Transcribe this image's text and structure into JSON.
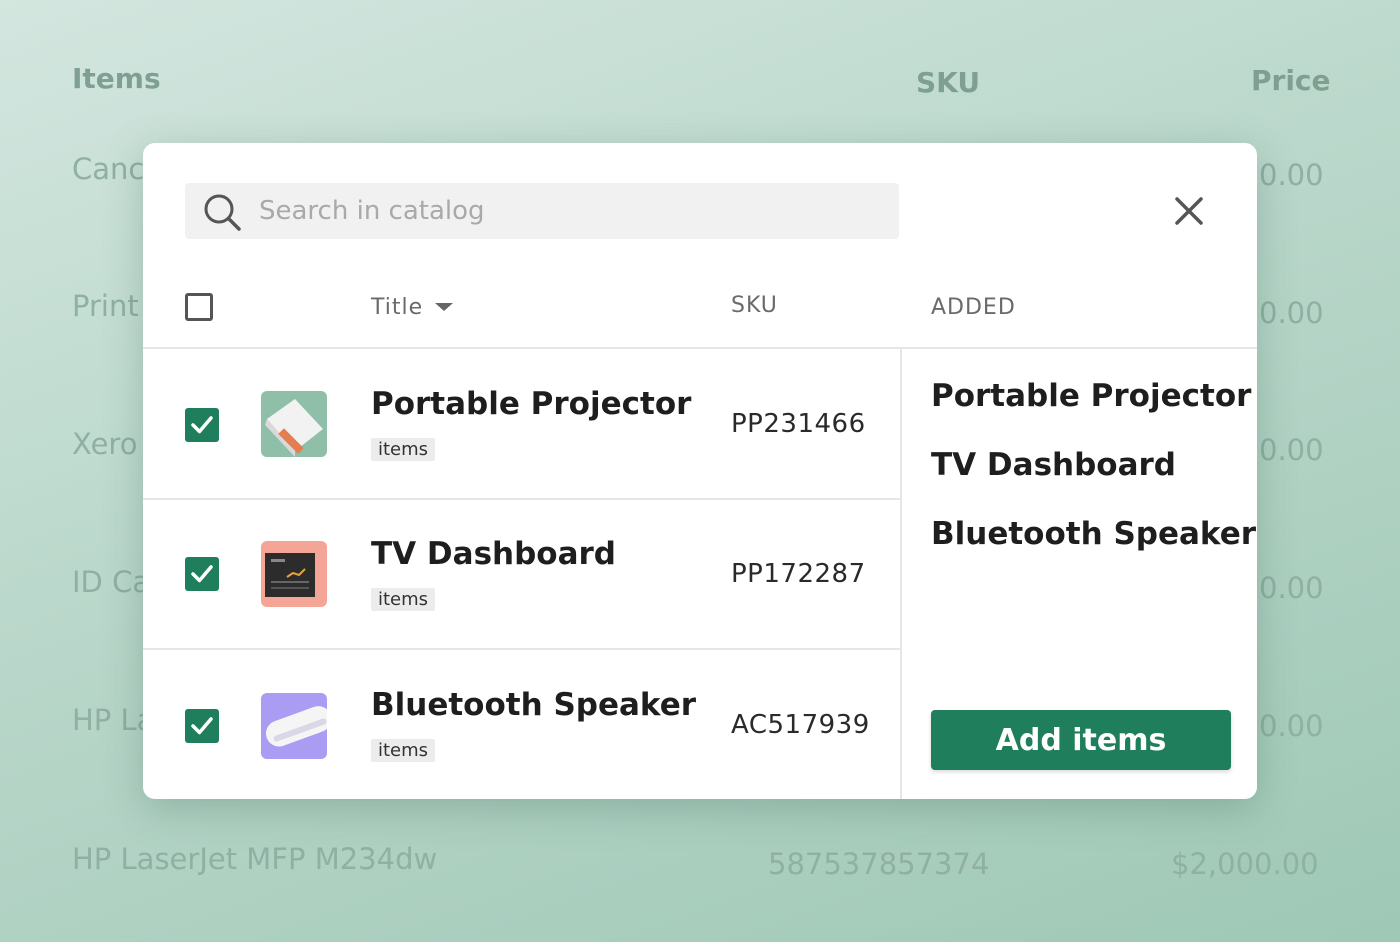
{
  "background": {
    "headers": {
      "items": "Items",
      "sku": "SKU",
      "price": "Price"
    },
    "rows": [
      {
        "item": "Canc",
        "price": "0.00"
      },
      {
        "item": "Print",
        "price": "0.00"
      },
      {
        "item": "Xero",
        "price": "0.00"
      },
      {
        "item": "ID Ca",
        "price": "0.00"
      },
      {
        "item": "HP La",
        "price": "0.00"
      },
      {
        "item": "HP LaserJet MFP M234dw",
        "sku": "587537857374",
        "price": "$2,000.00"
      }
    ]
  },
  "modal": {
    "search": {
      "placeholder": "Search in catalog",
      "icon": "search-icon"
    },
    "close_icon": "close-icon",
    "columns": {
      "title": "Title",
      "sku": "SKU",
      "added": "ADDED"
    },
    "products": [
      {
        "title": "Portable Projector",
        "badge": "items",
        "sku": "PP231466",
        "checked": true,
        "thumb_color": "#8fbfa8"
      },
      {
        "title": "TV Dashboard",
        "badge": "items",
        "sku": "PP172287",
        "checked": true,
        "thumb_color": "#f4a595"
      },
      {
        "title": "Bluetooth Speaker",
        "badge": "items",
        "sku": "AC517939",
        "checked": true,
        "thumb_color": "#a99cf2"
      }
    ],
    "added": [
      "Portable Projector",
      "TV Dashboard",
      "Bluetooth Speaker"
    ],
    "add_button_label": "Add items"
  },
  "colors": {
    "accent": "#1f7f5c",
    "background": "#b9d7ca"
  }
}
